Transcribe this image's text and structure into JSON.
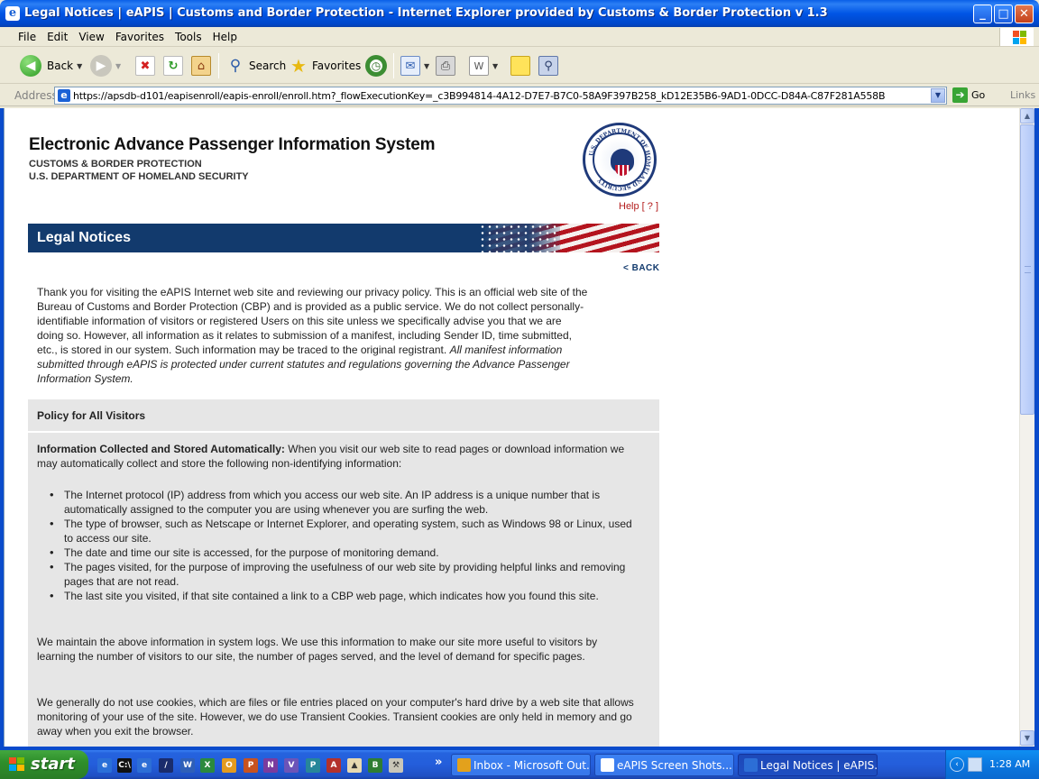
{
  "window": {
    "title": "Legal Notices | eAPIS | Customs and Border Protection - Internet Explorer provided by Customs & Border Protection v 1.3",
    "minimize": "_",
    "maximize": "□",
    "close": "✕"
  },
  "menu": [
    "File",
    "Edit",
    "View",
    "Favorites",
    "Tools",
    "Help"
  ],
  "toolbar": {
    "back": "Back",
    "search": "Search",
    "favorites": "Favorites"
  },
  "address": {
    "label": "Address",
    "url": "https://apsdb-d101/eapisenroll/eapis-enroll/enroll.htm?_flowExecutionKey=_c3B994814-4A12-D7E7-B7C0-58A9F397B258_kD12E35B6-9AD1-0DCC-D84A-C87F281A558B",
    "go": "Go",
    "links": "Links"
  },
  "page": {
    "system_title": "Electronic Advance Passenger Information System",
    "sub1": "CUSTOMS & BORDER PROTECTION",
    "sub2": "U.S. DEPARTMENT OF HOMELAND SECURITY",
    "seal_text": "U.S. DEPARTMENT OF HOMELAND SECURITY",
    "help": "Help [ ? ]",
    "banner_title": "Legal Notices",
    "back": "< BACK",
    "intro_plain": "Thank you for visiting the eAPIS Internet web site and reviewing our privacy policy. This is an official web site of the Bureau of Customs and Border Protection (CBP) and is provided as a public service. We do not collect personally-identifiable information of visitors or registered Users on this site unless we specifically advise you that we are doing so. However, all information as it relates to submission of a manifest, including Sender ID, time submitted, etc., is stored in our system. Such information may be traced to the original registrant.",
    "intro_italic": "All manifest information submitted through eAPIS is protected under current statutes and regulations governing the Advance Passenger Information System.",
    "policy_heading": "Policy for All Visitors",
    "auto_bold": "Information Collected and Stored Automatically:",
    "auto_text": "When you visit our web site to read pages or download information we may automatically collect and store the following non-identifying information:",
    "bullets": [
      "The Internet protocol (IP) address from which you access our web site. An IP address is a unique number that is automatically assigned to the computer you are using whenever you are surfing the web.",
      "The type of browser, such as Netscape or Internet Explorer, and operating system, such as Windows 98 or Linux, used to access our site.",
      "The date and time our site is accessed, for the purpose of monitoring demand.",
      "The pages visited, for the purpose of improving the usefulness of our web site by providing helpful links and removing pages that are not read.",
      "The last site you visited, if that site contained a link to a CBP web page, which indicates how you found this site."
    ],
    "para2": "We maintain the above information in system logs. We use this information to make our site more useful to visitors by learning the number of visitors to our site, the number of pages served, and the level of demand for specific pages.",
    "para3": "We generally do not use cookies, which are files or file entries placed on your computer's hard drive by a web site that allows monitoring of your use of the site. However, we do use Transient Cookies. Transient cookies are only held in memory and go away when you exit the browser."
  },
  "taskbar": {
    "start": "start",
    "tasks": [
      "Inbox - Microsoft Out...",
      "eAPIS Screen Shots....",
      "Legal Notices | eAPIS..."
    ],
    "clock": "1:28 AM",
    "overflow": "»"
  },
  "colors": {
    "banner": "#123a6d",
    "help": "#b31b1b",
    "policy_bg": "#e6e6e6"
  }
}
